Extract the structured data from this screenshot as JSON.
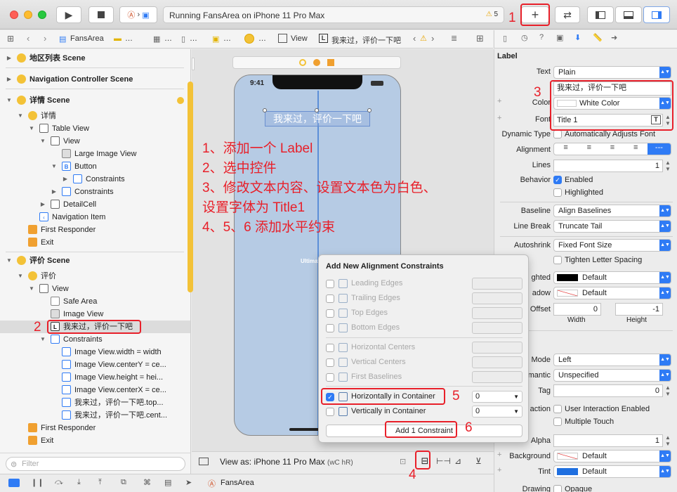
{
  "toolbar": {
    "run_icon": "play-icon",
    "stop_icon": "stop-icon",
    "activity_text": "Running FansArea on iPhone 11 Pro Max",
    "warning_count": "5",
    "library_icon": "plus-icon"
  },
  "jumpbar": {
    "items": [
      "FansArea",
      "…",
      "…",
      "…",
      "…",
      "View",
      "我来过，评价一下吧"
    ]
  },
  "navigator": {
    "scenes": [
      {
        "label": "地区列表 Scene"
      },
      {
        "label": "Navigation Controller Scene"
      },
      {
        "label": "详情 Scene"
      },
      {
        "label": "评价 Scene"
      }
    ],
    "detail_items": [
      "详情",
      "Table View",
      "View",
      "Large Image View",
      "Button",
      "Constraints",
      "Constraints",
      "DetailCell",
      "Navigation Item",
      "First Responder",
      "Exit"
    ],
    "review_items": [
      "评价",
      "View",
      "Safe Area",
      "Image View",
      "我来过，评价一下吧",
      "Constraints",
      "Image View.width = width",
      "Image View.centerY = ce...",
      "Image View.height = hei...",
      "Image View.centerX = ce...",
      "我来过，评价一下吧.top...",
      "我来过，评价一下吧.cent...",
      "First Responder",
      "Exit"
    ],
    "filter_placeholder": "Filter"
  },
  "canvas": {
    "status_time": "9:41",
    "label_text": "我来过，评价一下吧",
    "watermark": "Ultimate",
    "view_as": "View as: iPhone 11 Pro Max",
    "size_class": "(wC hR)"
  },
  "instructions": [
    "1、添加一个 Label",
    "2、选中控件",
    "3、修改文本内容、设置文本色为白色、",
    "设置字体为 Title1",
    "4、5、6 添加水平约束"
  ],
  "popover": {
    "title": "Add New Alignment Constraints",
    "rows": [
      {
        "label": "Leading Edges",
        "enabled": false,
        "checked": false,
        "value": ""
      },
      {
        "label": "Trailing Edges",
        "enabled": false,
        "checked": false,
        "value": ""
      },
      {
        "label": "Top Edges",
        "enabled": false,
        "checked": false,
        "value": ""
      },
      {
        "label": "Bottom Edges",
        "enabled": false,
        "checked": false,
        "value": ""
      },
      {
        "label": "Horizontal Centers",
        "enabled": false,
        "checked": false,
        "value": ""
      },
      {
        "label": "Vertical Centers",
        "enabled": false,
        "checked": false,
        "value": ""
      },
      {
        "label": "First Baselines",
        "enabled": false,
        "checked": false,
        "value": ""
      },
      {
        "label": "Horizontally in Container",
        "enabled": true,
        "checked": true,
        "value": "0"
      },
      {
        "label": "Vertically in Container",
        "enabled": true,
        "checked": false,
        "value": "0"
      }
    ],
    "button": "Add 1 Constraint"
  },
  "inspector": {
    "section": "Label",
    "text_label": "Text",
    "text_value": "Plain",
    "text_content": "我来过，评价一下吧",
    "color_label": "Color",
    "color_value": "White Color",
    "font_label": "Font",
    "font_value": "Title 1",
    "dyn_label": "Dynamic Type",
    "dyn_value": "Automatically Adjusts Font",
    "align_label": "Alignment",
    "lines_label": "Lines",
    "lines_value": "1",
    "behavior_label": "Behavior",
    "enabled_label": "Enabled",
    "highlighted_label": "Highlighted",
    "baseline_label": "Baseline",
    "baseline_value": "Align Baselines",
    "linebreak_label": "Line Break",
    "linebreak_value": "Truncate Tail",
    "autoshrink_label": "Autoshrink",
    "autoshrink_value": "Fixed Font Size",
    "tighten_label": "Tighten Letter Spacing",
    "highlighted2_label": "ghted",
    "highlighted2_value": "Default",
    "shadow_label": "adow",
    "shadow_value": "Default",
    "offset_label": "Offset",
    "offset_w": "0",
    "offset_h": "-1",
    "width_label": "Width",
    "height_label": "Height",
    "mode_label": "Mode",
    "mode_value": "Left",
    "semantic_label": "mantic",
    "semantic_value": "Unspecified",
    "tag_label": "Tag",
    "tag_value": "0",
    "interaction_label": "action",
    "uie_label": "User Interaction Enabled",
    "multitouch_label": "Multiple Touch",
    "alpha_label": "Alpha",
    "alpha_value": "1",
    "background_label": "Background",
    "background_value": "Default",
    "tint_label": "Tint",
    "tint_value": "Default",
    "drawing_label": "Drawing",
    "opaque_label": "Opaque"
  },
  "annotations": {
    "n1": "1",
    "n2": "2",
    "n3": "3",
    "n4": "4",
    "n5": "5",
    "n6": "6"
  },
  "debugbar": {
    "scheme": "FansArea"
  }
}
